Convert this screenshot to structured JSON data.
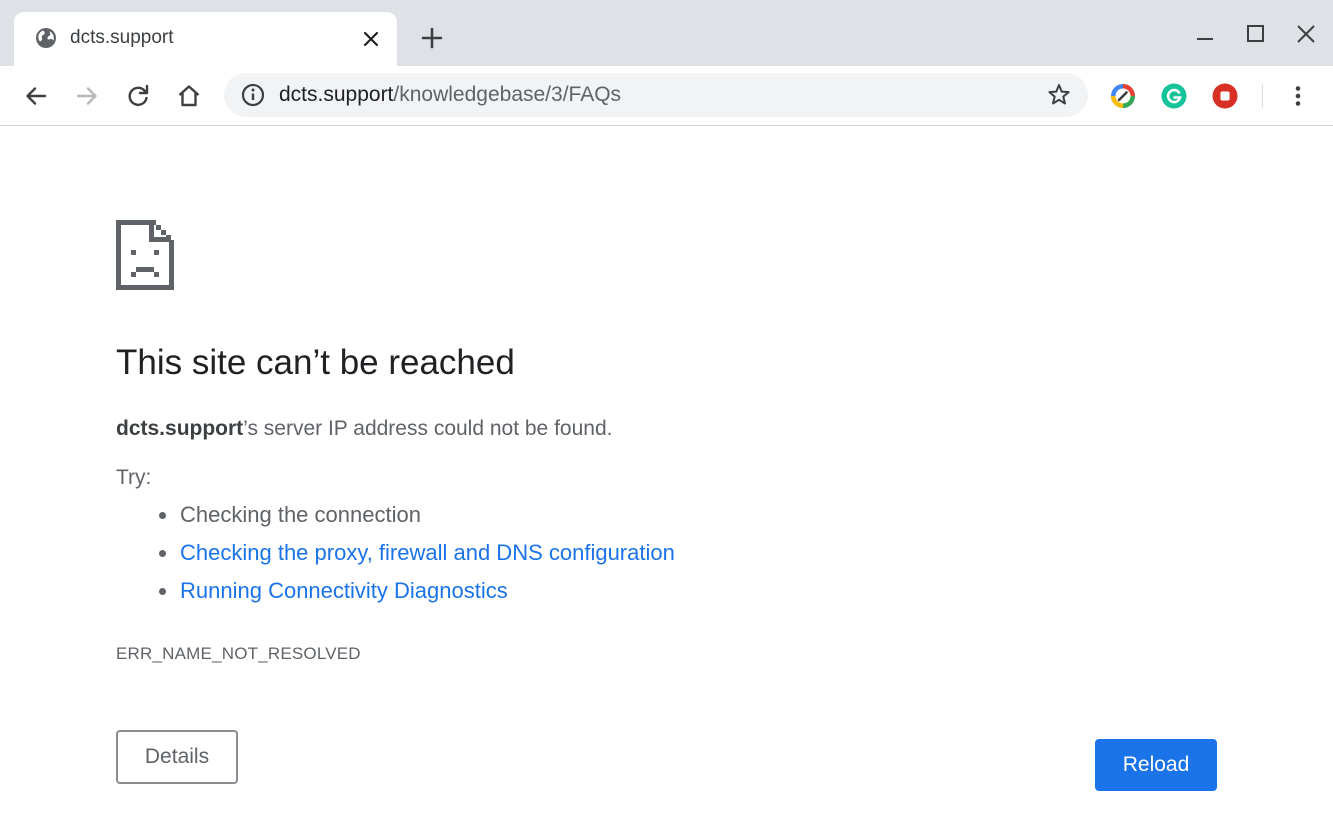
{
  "tab": {
    "title": "dcts.support",
    "favicon": "globe-icon"
  },
  "toolbar": {
    "url_host": "dcts.support",
    "url_path": "/knowledgebase/3/FAQs",
    "extensions": [
      "color-picker-extension-icon",
      "grammarly-extension-icon",
      "stop-extension-icon"
    ]
  },
  "error": {
    "title": "This site can’t be reached",
    "host": "dcts.support",
    "message": "’s server IP address could not be found.",
    "try_label": "Try:",
    "suggestions": [
      {
        "text": "Checking the connection",
        "link": false
      },
      {
        "text": "Checking the proxy, firewall and DNS configuration",
        "link": true
      },
      {
        "text": "Running Connectivity Diagnostics",
        "link": true
      }
    ],
    "code": "ERR_NAME_NOT_RESOLVED",
    "details_label": "Details",
    "reload_label": "Reload"
  },
  "colors": {
    "link": "#1a73e8",
    "primary_button": "#1a73e8",
    "tab_strip": "#dee1e6",
    "text_secondary": "#5f6368",
    "text_primary": "#202124"
  }
}
